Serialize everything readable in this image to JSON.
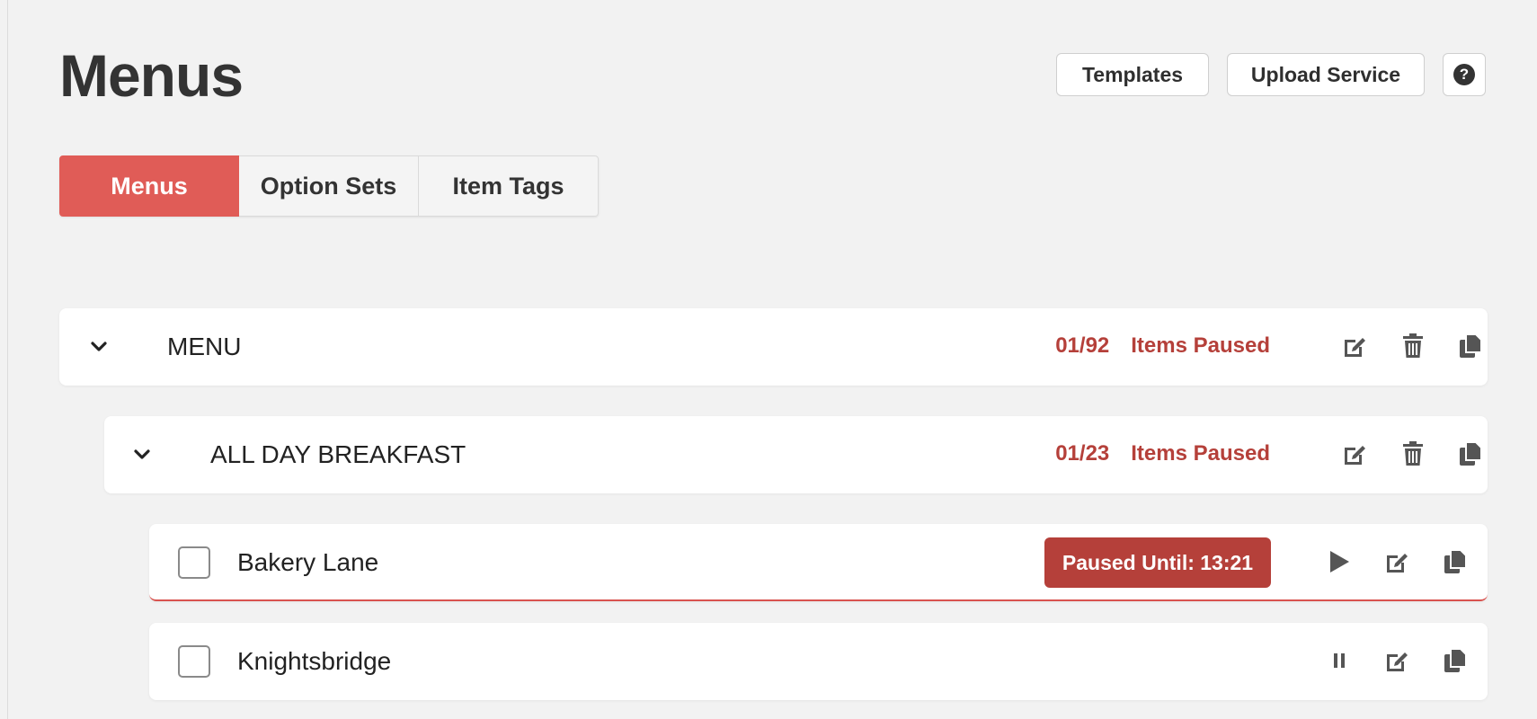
{
  "page": {
    "title": "Menus"
  },
  "top_actions": {
    "templates_label": "Templates",
    "upload_label": "Upload Service",
    "help_glyph": "?"
  },
  "tabs": [
    {
      "label": "Menus",
      "active": true
    },
    {
      "label": "Option Sets",
      "active": false
    },
    {
      "label": "Item Tags",
      "active": false
    }
  ],
  "rows": {
    "menu": {
      "name": "MENU",
      "paused_count": "01/92",
      "paused_label": "Items Paused"
    },
    "category": {
      "name": "ALL DAY BREAKFAST",
      "paused_count": "01/23",
      "paused_label": "Items Paused"
    },
    "items": [
      {
        "name": "Bakery Lane",
        "status_badge": "Paused Until: 13:21",
        "action_icon": "play-icon"
      },
      {
        "name": "Knightsbridge",
        "status_badge": "",
        "action_icon": "pause-icon"
      }
    ]
  },
  "colors": {
    "accent": "#e05c57",
    "paused": "#b5403a",
    "background": "#f2f2f2"
  }
}
